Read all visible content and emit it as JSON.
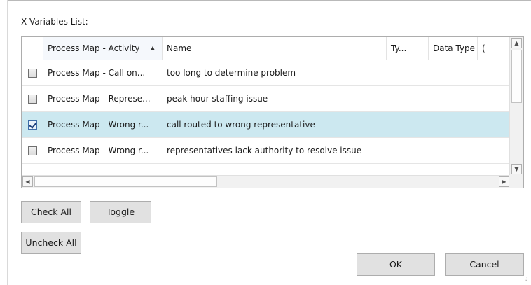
{
  "dialog": {
    "list_label": "X Variables List:"
  },
  "grid": {
    "columns": [
      {
        "label": "",
        "sorted": false
      },
      {
        "label": "Process Map - Activity",
        "sorted": true,
        "sort_direction": "ascending"
      },
      {
        "label": "Name",
        "sorted": false
      },
      {
        "label": "Ty...",
        "sorted": false
      },
      {
        "label": "Data Type",
        "sorted": false
      },
      {
        "label": "(",
        "sorted": false
      }
    ],
    "rows": [
      {
        "checked": false,
        "selected": false,
        "activity": "Process Map - Call on...",
        "name": "too long to determine problem",
        "type": "",
        "data_type": ""
      },
      {
        "checked": false,
        "selected": false,
        "activity": "Process Map - Represe...",
        "name": "peak hour staffing issue",
        "type": "",
        "data_type": ""
      },
      {
        "checked": true,
        "selected": true,
        "activity": "Process Map - Wrong r...",
        "name": "call routed to wrong representative",
        "type": "",
        "data_type": ""
      },
      {
        "checked": false,
        "selected": false,
        "activity": "Process Map - Wrong r...",
        "name": "representatives lack authority to resolve issue",
        "type": "",
        "data_type": ""
      }
    ],
    "vscroll_position": 0,
    "hscroll_position": 0
  },
  "buttons": {
    "check_all": "Check All",
    "toggle": "Toggle",
    "uncheck_all": "Uncheck All",
    "ok": "OK",
    "cancel": "Cancel"
  },
  "icons": {
    "scroll_up": "scroll-up-arrow-icon",
    "scroll_down": "scroll-down-arrow-icon",
    "scroll_left": "scroll-left-arrow-icon",
    "scroll_right": "scroll-right-arrow-icon",
    "sort_ascending": "sort-ascending-icon"
  },
  "colors": {
    "selected_row": "#cce8f0",
    "button_face": "#e1e1e1",
    "grid_border": "#adadad"
  }
}
